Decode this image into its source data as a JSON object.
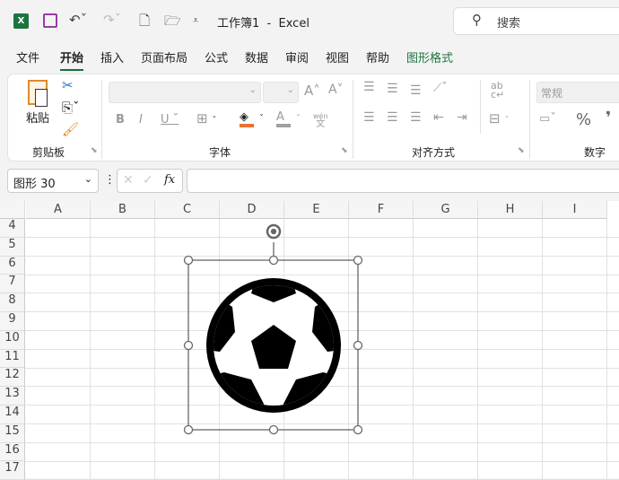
{
  "title_bar": {
    "doc_title": "工作簿1  -  Excel",
    "search_placeholder": "搜索"
  },
  "tabs": [
    "文件",
    "开始",
    "插入",
    "页面布局",
    "公式",
    "数据",
    "审阅",
    "视图",
    "帮助",
    "图形格式"
  ],
  "active_tab": "开始",
  "ribbon": {
    "clipboard": {
      "paste_label": "粘贴",
      "group_label": "剪贴板"
    },
    "font": {
      "group_label": "字体",
      "phonetic_top": "wén",
      "phonetic_bottom": "文"
    },
    "alignment": {
      "group_label": "对齐方式"
    },
    "number": {
      "format_value": "常规",
      "group_label": "数字",
      "percent": "%"
    }
  },
  "formula_bar": {
    "name_box": "图形 30",
    "fx": "fx",
    "formula": ""
  },
  "sheet": {
    "columns": [
      "A",
      "B",
      "C",
      "D",
      "E",
      "F",
      "G",
      "H",
      "I"
    ],
    "rows": [
      "4",
      "5",
      "6",
      "7",
      "8",
      "9",
      "10",
      "11",
      "12",
      "13",
      "14",
      "15",
      "16",
      "17"
    ],
    "shape": {
      "icon": "soccer-ball-icon",
      "selected": true
    }
  },
  "colors": {
    "excel_green": "#1d7340",
    "fill_color": "#e97132",
    "font_color": "#a0a0a0"
  }
}
